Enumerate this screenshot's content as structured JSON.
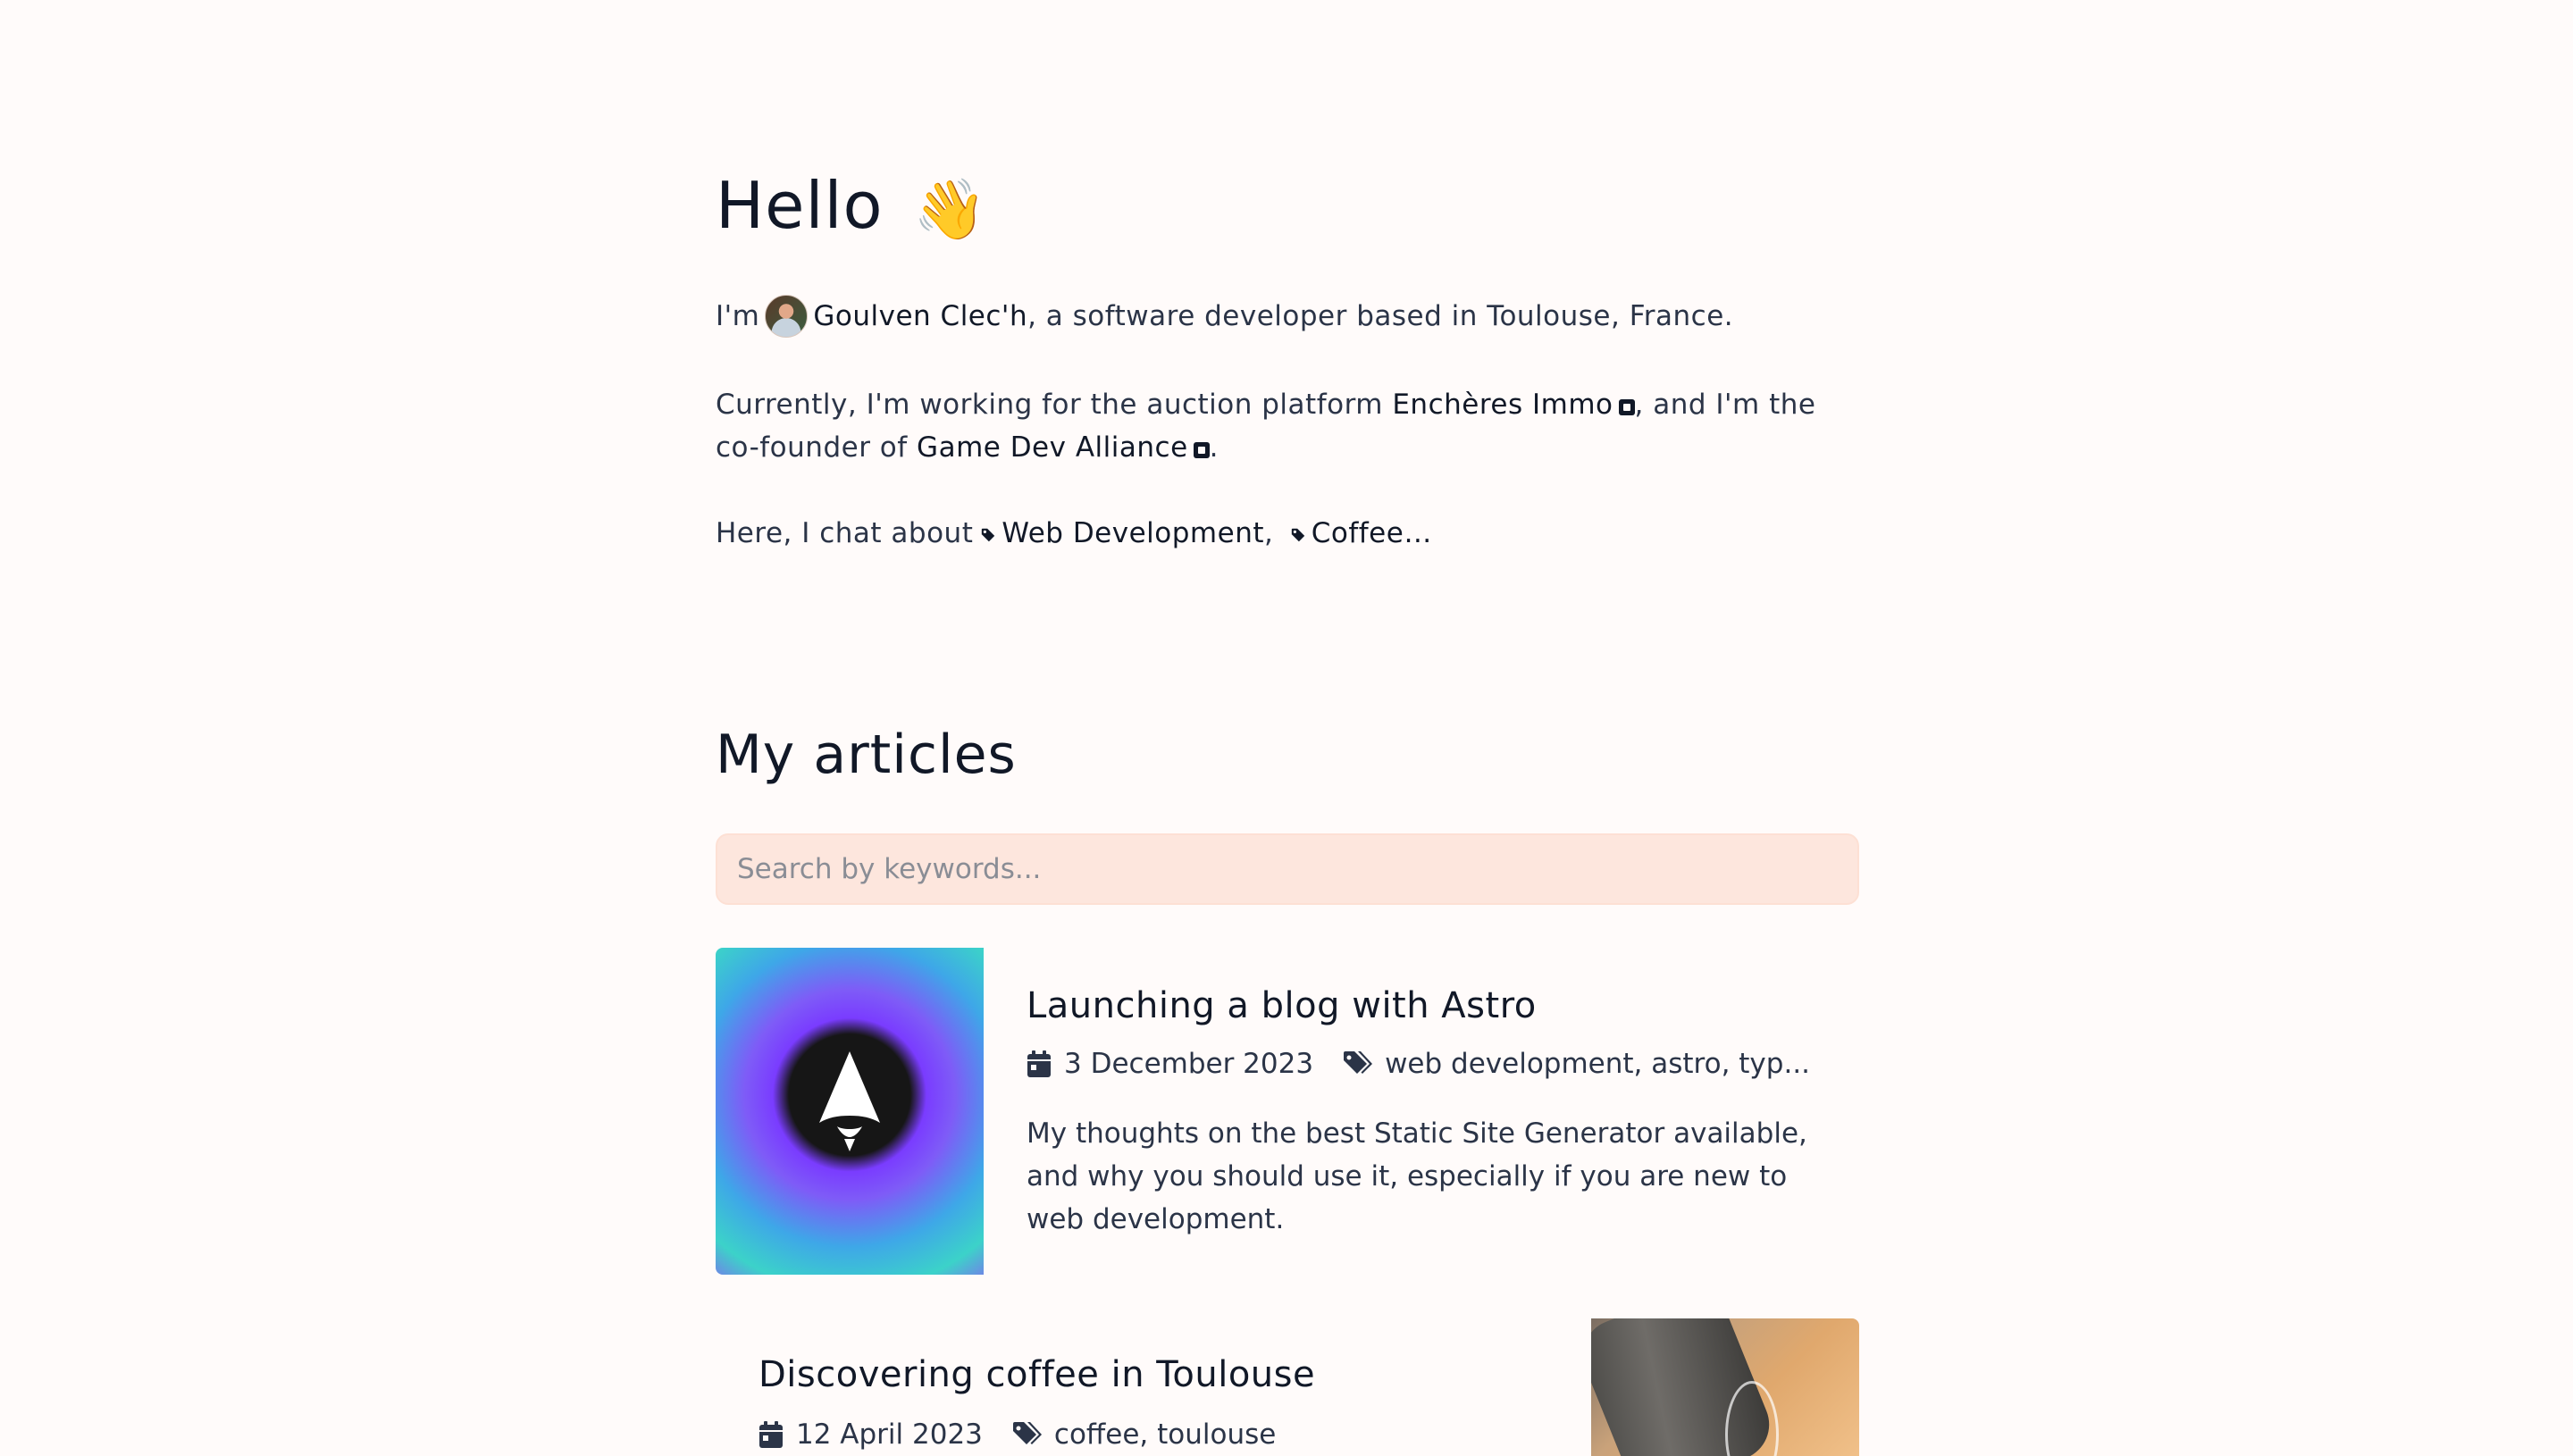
{
  "hero": {
    "title": "Hello",
    "wave_emoji": "👋",
    "intro_prefix": "I'm",
    "author_name": "Goulven Clec'h",
    "intro_suffix": ", a software developer based in Toulouse, France.",
    "work_prefix": "Currently, I'm working for the auction platform",
    "work_company": "Enchères Immo",
    "work_middle": ", and I'm the co-founder of",
    "work_project": "Game Dev Alliance",
    "work_end": ".",
    "chat_prefix": "Here, I chat about",
    "topics": [
      "Web Development",
      "Coffee"
    ],
    "topic_separator": ",",
    "topics_ellipsis": "…"
  },
  "articles": {
    "heading": "My articles",
    "search_placeholder": "Search by keywords...",
    "items": [
      {
        "title": "Launching a blog with Astro",
        "date": "3 December 2023",
        "tags": "web development, astro, typ...",
        "excerpt": "My thoughts on the best Static Site Generator available, and why you should use it, especially if you are new to web development."
      },
      {
        "title": "Discovering coffee in Toulouse",
        "date": "12 April 2023",
        "tags": "coffee, toulouse"
      }
    ]
  },
  "colors": {
    "background": "#fffbfa",
    "search_bg": "#fde6dd",
    "text": "#2b3447",
    "heading": "#111827"
  }
}
